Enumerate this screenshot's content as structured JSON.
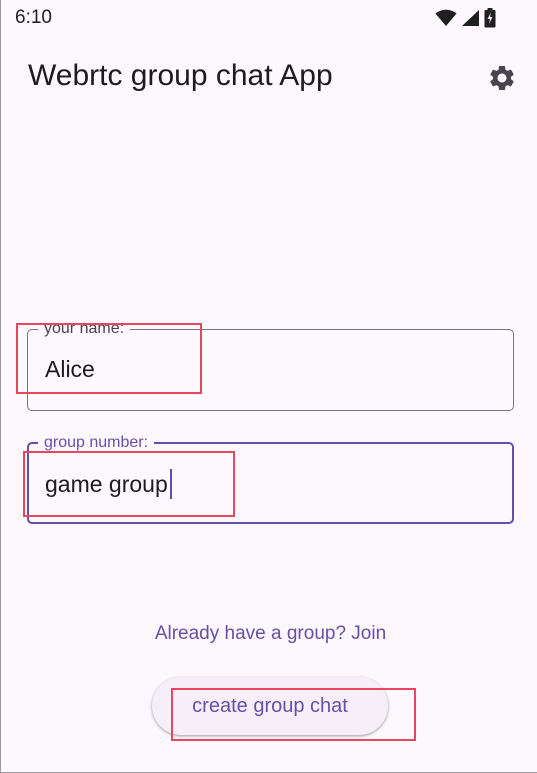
{
  "status_bar": {
    "time": "6:10",
    "icons": [
      "wifi-icon",
      "signal-icon",
      "battery-icon"
    ]
  },
  "app_bar": {
    "title": "Webrtc group chat App",
    "settings_icon": "gear-icon"
  },
  "form": {
    "name_field": {
      "label": "your name:",
      "value": "Alice"
    },
    "group_field": {
      "label": "group number:",
      "value": "game group",
      "focused": true
    }
  },
  "actions": {
    "join_link": "Already have a group? Join",
    "create_button": "create group chat"
  },
  "colors": {
    "background": "#FDF7FE",
    "primary": "#6750A4",
    "outline": "#79747E",
    "annotation": "#E8455E"
  }
}
